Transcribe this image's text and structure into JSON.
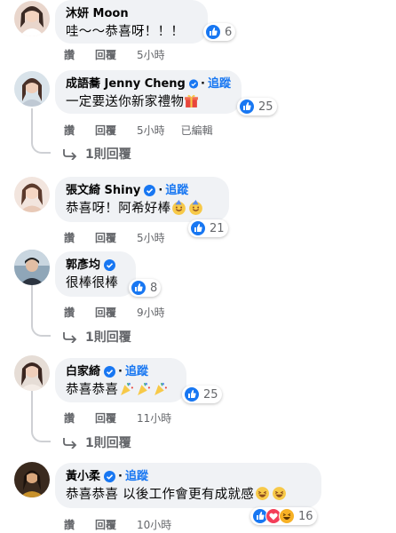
{
  "actions": {
    "like": "讚",
    "reply": "回覆",
    "edited": "已編輯",
    "follow": "追蹤"
  },
  "comments": [
    {
      "name": "沐妍 Moon",
      "text": "哇～～恭喜呀！！！",
      "likes": "6",
      "time": "5小時"
    },
    {
      "name": "成語蕎 Jenny Cheng",
      "text": "一定要送你新家禮物",
      "likes": "25",
      "time": "5小時",
      "replies": "1則回覆"
    },
    {
      "name": "張文綺 Shiny",
      "text": "恭喜呀！阿希好棒",
      "likes": "21",
      "time": "5小時"
    },
    {
      "name": "郭彥均",
      "text": "很棒很棒",
      "likes": "8",
      "time": "9小時",
      "replies": "1則回覆"
    },
    {
      "name": "白家綺",
      "text": "恭喜恭喜",
      "likes": "25",
      "time": "11小時",
      "replies": "1則回覆"
    },
    {
      "name": "黃小柔",
      "text": "恭喜恭喜 以後工作會更有成就感",
      "likes": "16",
      "time": "10小時"
    }
  ],
  "colors": {
    "accent": "#1877f2",
    "bubble": "#f0f2f5",
    "meta": "#65676b",
    "love": "#f33e58",
    "haha": "#f7b125"
  }
}
